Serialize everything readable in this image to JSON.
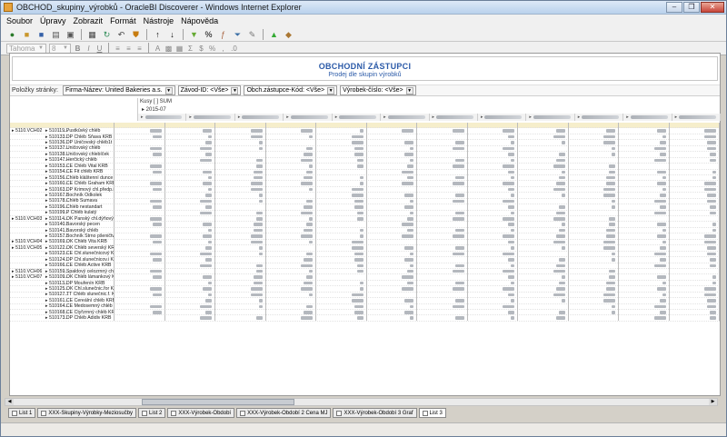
{
  "window": {
    "title": "OBCHOD_skupiny_výrobků - OracleBI Discoverer - Windows Internet Explorer",
    "buttons": [
      "–",
      "❐",
      "✕"
    ]
  },
  "menu": {
    "items": [
      "Soubor",
      "Úpravy",
      "Zobrazit",
      "Formát",
      "Nástroje",
      "Nápověda"
    ]
  },
  "toolbar2": {
    "font": "Tahoma",
    "size": "8"
  },
  "report": {
    "title": "OBCHODNÍ ZÁSTUPCI",
    "subtitle": "Prodej dle skupin výrobků"
  },
  "page_items": {
    "label": "Položky stránky:",
    "items": [
      "Firma-Název: United Bakeries a.s.",
      "Závod-ID: <Vše>",
      "Obch.zástupce-Kód: <Vše>",
      "Výrobek-číslo: <Vše>"
    ]
  },
  "crosstab": {
    "measure": "Kusy [ ] SUM",
    "month": "▸ 2015-07",
    "rows": [
      {
        "group": "",
        "item": "",
        "code": "",
        "name": "",
        "sel": true
      },
      {
        "group": "▸ 5110.VCH02",
        "code": "▸ 510119...",
        "name": "..Pustkůvký chléb"
      },
      {
        "group": "",
        "code": "▸ 510133...",
        "name": "..DP Chléb Šňava KRB"
      },
      {
        "group": "",
        "code": "▸ 510136...",
        "name": "..DP Uničovský chléb1t KRB"
      },
      {
        "group": "",
        "code": "▸ 510137...",
        "name": "..Uničovský chléb"
      },
      {
        "group": "",
        "code": "▸ 510138...",
        "name": "..Uničovský chlebíček"
      },
      {
        "group": "",
        "code": "▸ 510147...",
        "name": "..Herčický chléb"
      },
      {
        "group": "",
        "code": "▸ 510153...",
        "name": "..CE Chléb Vital KRB"
      },
      {
        "group": "",
        "code": "▸ 510154...",
        "name": "..CE Fit chléb KRB"
      },
      {
        "group": "",
        "code": "▸ 510156...",
        "name": "..Chléb kláštenní dunce"
      },
      {
        "group": "",
        "code": "▸ 510160...",
        "name": "..CE Chléb Graham KRB"
      },
      {
        "group": "",
        "code": "▸ 510163...",
        "name": "..DP Krimový chl.předp.ier"
      },
      {
        "group": "",
        "code": "▸ 510167...",
        "name": "..Bochník Odkolek"
      },
      {
        "group": "",
        "code": "▸ 510178...",
        "name": "..Chléb Šumava"
      },
      {
        "group": "",
        "code": "▸ 510196...",
        "name": "..Chléb nestandart"
      },
      {
        "group": "",
        "code": "▸ 510199...",
        "name": "..P Chléb kulatý"
      },
      {
        "group": "▸ 5110.VCH03",
        "code": "▸ 510114...",
        "name": "..OK Panský chl.dýňový KRB"
      },
      {
        "group": "",
        "code": "▸ 510140...",
        "name": "..Bavorský pecen"
      },
      {
        "group": "",
        "code": "▸ 510141...",
        "name": "..Bavorský chléb"
      },
      {
        "group": "",
        "code": "▸ 510157...",
        "name": "..Bochník Strno pšeničtv"
      },
      {
        "group": "▸ 5110.VCH04",
        "code": "▸ 510169...",
        "name": "..OK Chléb Vita KRB"
      },
      {
        "group": "▸ 5110.VCH05",
        "code": "▸ 510122...",
        "name": "..OK Chléb severský KRB"
      },
      {
        "group": "",
        "code": "▸ 510123...",
        "name": "..CE Chl.slunečnicový KRB"
      },
      {
        "group": "",
        "code": "▸ 510124...",
        "name": "..DP Chl.slunečnicov.i KRB"
      },
      {
        "group": "",
        "code": "▸ 510166...",
        "name": "..CE Chléb Active KRB"
      },
      {
        "group": "▸ 5110.VCH06",
        "code": "▸ 510159...",
        "name": "..Špaldový celozrnný chléb"
      },
      {
        "group": "▸ 5110.VCH07",
        "code": "▸ 510109...",
        "name": "..OK Chléb lámankový KRB"
      },
      {
        "group": "",
        "code": "▸ 510113...",
        "name": "..DP Mouřenín KRB"
      },
      {
        "group": "",
        "code": "▸ 510125...",
        "name": "..OK Chl.slunečnic.for KRB"
      },
      {
        "group": "",
        "code": "▸ 510127...",
        "name": "..TT Chléb slunečnic.f. KRB"
      },
      {
        "group": "",
        "code": "▸ 510161...",
        "name": "..CE Cereální chléb KRB"
      },
      {
        "group": "",
        "code": "▸ 510164...",
        "name": "..CE Medosemný chléb KRB"
      },
      {
        "group": "",
        "code": "▸ 510168...",
        "name": "..CE Čtyřzrnný chléb KRB"
      },
      {
        "group": "",
        "code": "▸ 510173...",
        "name": "..DP Chléb Adidiv KRB"
      }
    ]
  },
  "sheet_tabs": [
    "List 1",
    "XXX-Skupiny-Výrobky-Meziosučby",
    "List 2",
    "XXX-Výrobek-Období",
    "XXX-Výrobek-Období 2 Cena MJ",
    "XXX-Výrobek-Období 3 Graf",
    "List 3"
  ],
  "colors": {
    "title_blue": "#2b5aa8",
    "selected_row": "#f6eecb"
  }
}
